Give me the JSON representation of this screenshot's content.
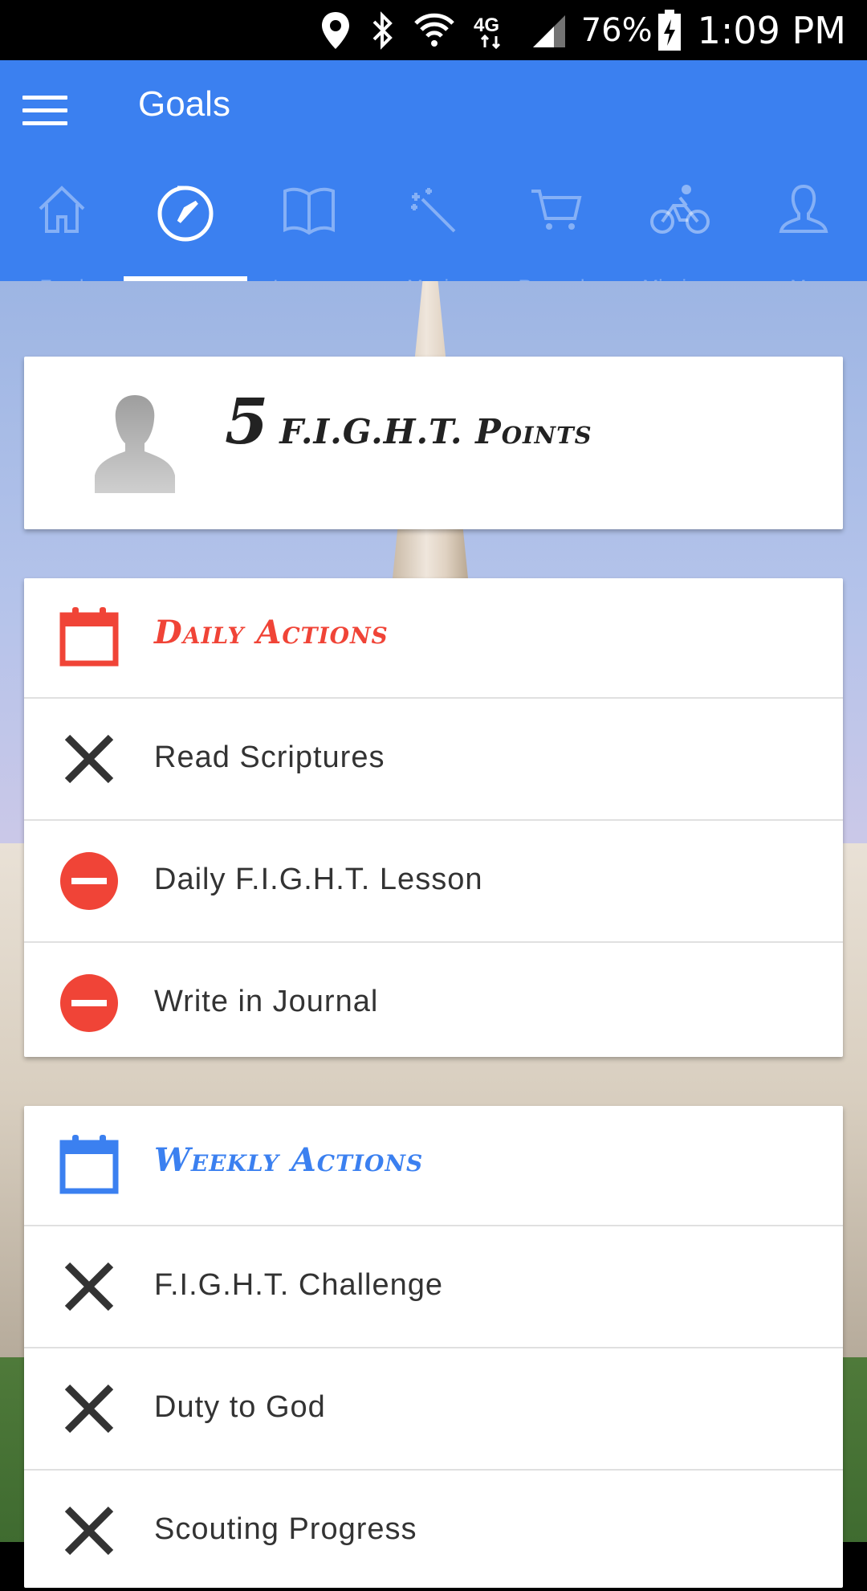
{
  "status_bar": {
    "battery": "76%",
    "time": "1:09 PM",
    "icons": [
      "location-icon",
      "bluetooth-icon",
      "wifi-icon",
      "network-4g-lte-icon",
      "signal-icon",
      "battery-charging-icon"
    ]
  },
  "app_bar": {
    "title": "Goals",
    "tabs": [
      {
        "icon": "home-icon",
        "label": "Feed"
      },
      {
        "icon": "compass-icon",
        "label": "Goals",
        "active": true
      },
      {
        "icon": "book-icon",
        "label": "Lessons"
      },
      {
        "icon": "magic-wand-icon",
        "label": "Magic"
      },
      {
        "icon": "cart-icon",
        "label": "Rewards"
      },
      {
        "icon": "bike-icon",
        "label": "Missions"
      },
      {
        "icon": "profile-icon",
        "label": "Me"
      }
    ]
  },
  "points": {
    "value": "5",
    "label": "F.I.G.H.T. Points"
  },
  "daily": {
    "title": "Daily Actions",
    "color": "#f04437",
    "items": [
      {
        "label": "Read Scriptures",
        "status": "x-icon"
      },
      {
        "label": "Daily F.I.G.H.T. Lesson",
        "status": "minus-circle-icon"
      },
      {
        "label": "Write in Journal",
        "status": "minus-circle-icon"
      }
    ]
  },
  "weekly": {
    "title": "Weekly Actions",
    "color": "#3b80f0",
    "items": [
      {
        "label": "F.I.G.H.T. Challenge",
        "status": "x-icon"
      },
      {
        "label": "Duty to God",
        "status": "x-icon"
      },
      {
        "label": "Scouting Progress",
        "status": "x-icon"
      }
    ]
  }
}
